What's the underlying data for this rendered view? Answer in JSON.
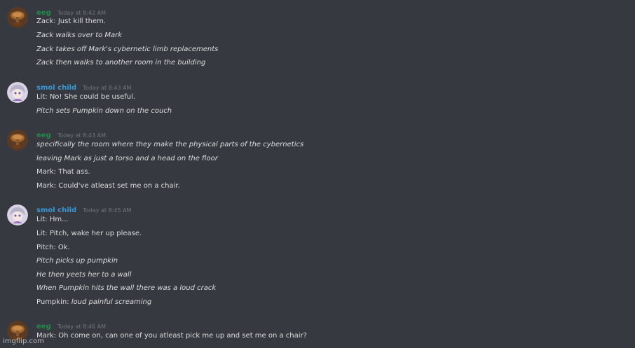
{
  "messages": [
    {
      "username": "eeg",
      "timestamp": "Today at 8:42 AM",
      "lines": [
        {
          "prefix": "Zack: Just kill them.",
          "italic": ""
        },
        {
          "prefix": "",
          "italic": "Zack walks over to Mark"
        },
        {
          "prefix": "",
          "italic": "Zack takes off Mark's cybernetic limb replacements"
        },
        {
          "prefix": "",
          "italic": "Zack then walks to another room in the building"
        }
      ]
    },
    {
      "username": "smol child",
      "timestamp": "Today at 8:43 AM",
      "lines": [
        {
          "prefix": "Lit: No! She could be useful.",
          "italic": ""
        },
        {
          "prefix": "",
          "italic": "Pitch sets Pumpkin down on the couch"
        }
      ]
    },
    {
      "username": "eeg",
      "timestamp": "Today at 8:43 AM",
      "lines": [
        {
          "prefix": "",
          "italic": "specifically the room where they make the physical parts of the cybernetics"
        },
        {
          "prefix": "",
          "italic": "leaving Mark as just a torso and a head on the floor"
        },
        {
          "prefix": "Mark: That ass.",
          "italic": ""
        },
        {
          "prefix": "Mark: Could've atleast set me on a chair.",
          "italic": ""
        }
      ]
    },
    {
      "username": "smol child",
      "timestamp": "Today at 8:45 AM",
      "lines": [
        {
          "prefix": "Lit: Hm...",
          "italic": ""
        },
        {
          "prefix": "Lit: Pitch, wake her up please.",
          "italic": ""
        },
        {
          "prefix": "Pitch: Ok.",
          "italic": ""
        },
        {
          "prefix": "",
          "italic": "Pitch picks up pumpkin"
        },
        {
          "prefix": "",
          "italic": "He then yeets her to a wall"
        },
        {
          "prefix": "",
          "italic": "When Pumpkin hits the wall there was a loud crack"
        },
        {
          "prefix": "Pumpkin: ",
          "italic": "loud painful screaming"
        }
      ]
    },
    {
      "username": "eeg",
      "timestamp": "Today at 8:46 AM",
      "lines": [
        {
          "prefix": "Mark: Oh come on, can one of you atleast pick me up and set me on a chair?",
          "italic": ""
        }
      ]
    }
  ],
  "watermark": "imgflip.com",
  "colors": {
    "background": "#36393f",
    "eeg_name": "#1f8b4c",
    "smol_child_name": "#3498db",
    "text": "#dcddde",
    "timestamp": "#72767d"
  }
}
